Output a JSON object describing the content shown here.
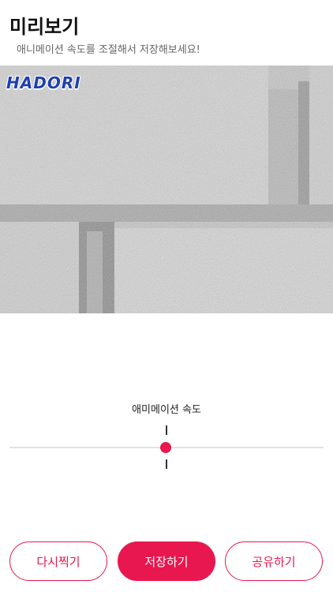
{
  "header": {
    "title": "미리보기",
    "subtitle": "애니메이션 속도를 조절해서 저장해보세요!"
  },
  "preview": {
    "logo_text": "HADORI",
    "image": "brick-wall-grayscale"
  },
  "speed": {
    "label": "애미메이션 속도",
    "value_fraction": 0.5
  },
  "actions": {
    "retake_label": "다시찍기",
    "save_label": "저장하기",
    "share_label": "공유하기"
  },
  "colors": {
    "accent": "#e8174f"
  }
}
